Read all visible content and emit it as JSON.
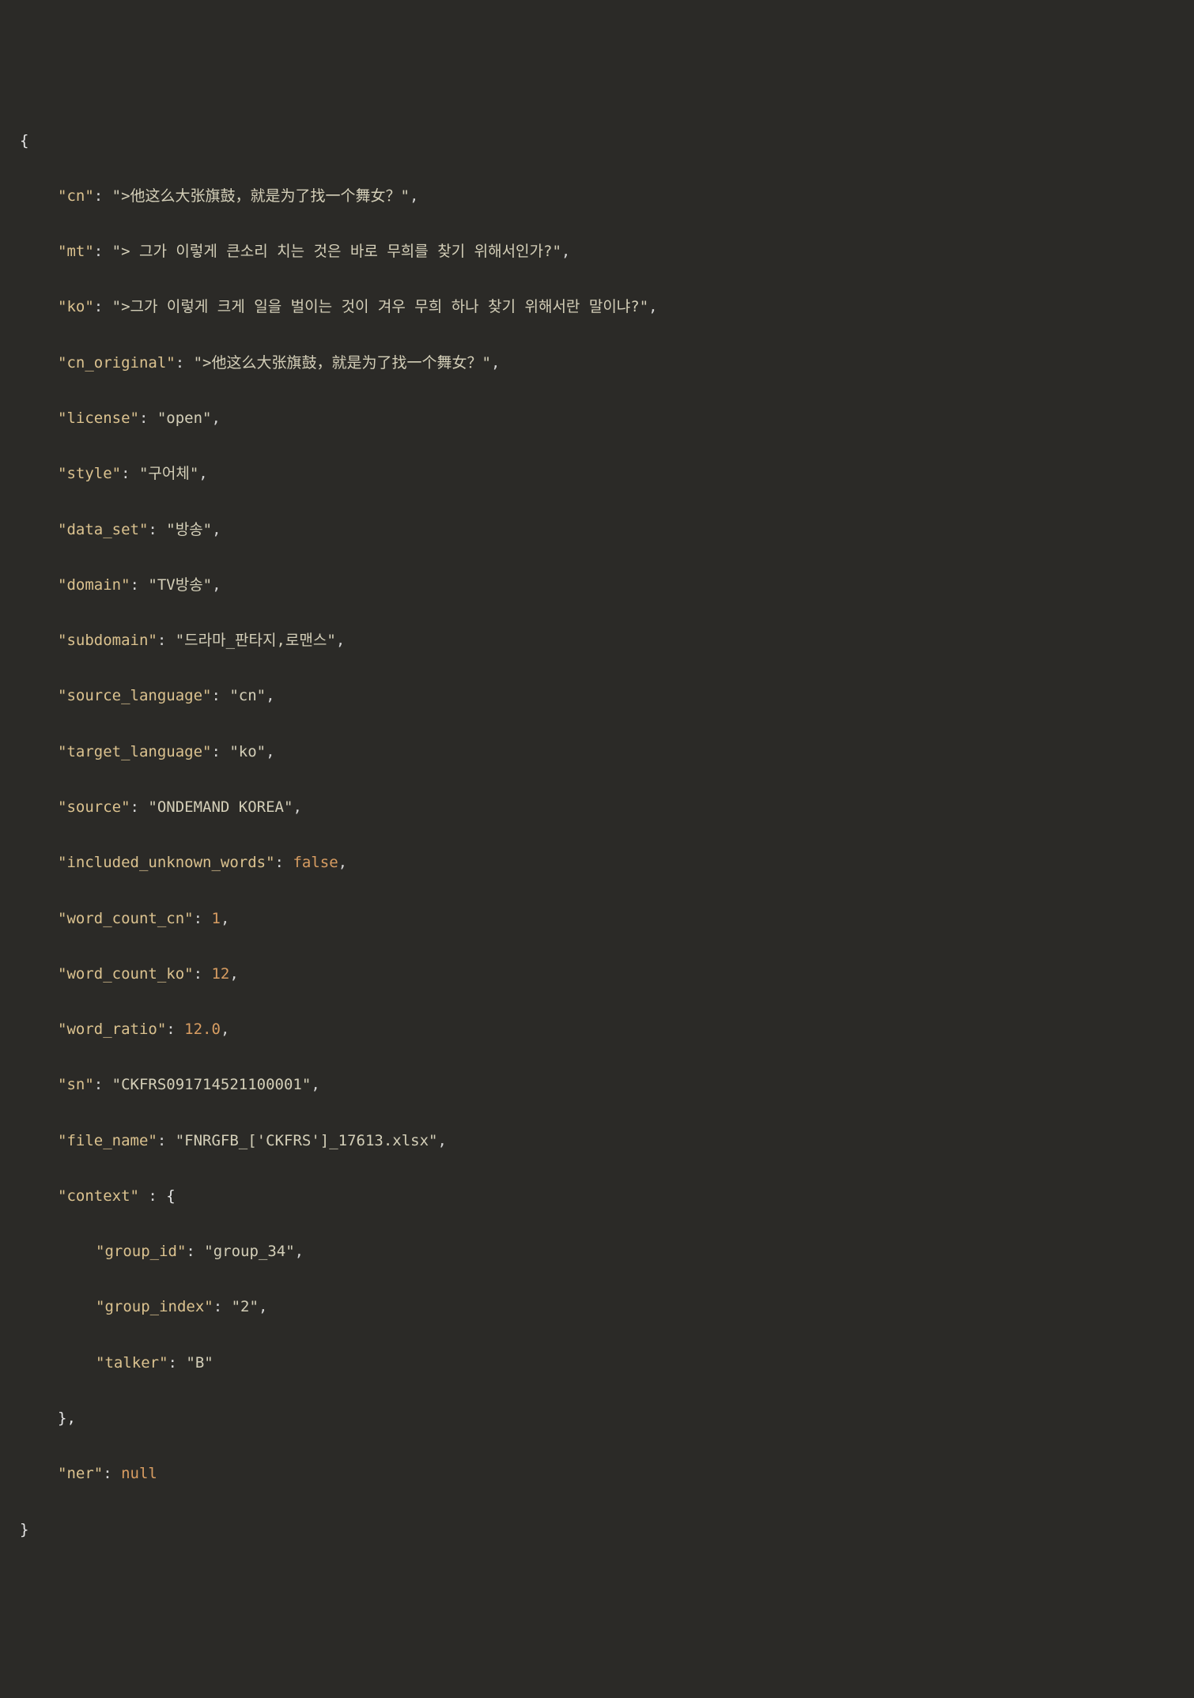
{
  "open_brace": "{",
  "close_brace": "}",
  "close_brace_comma": "},",
  "cn_key": "\"cn\"",
  "cn_val": "\">他这么大张旗鼓，就是为了找一个舞女？\"",
  "mt_key": "\"mt\"",
  "mt_val": "\"> 그가 이렇게 큰소리 치는 것은 바로 무희를 찾기 위해서인가?\"",
  "ko_key": "\"ko\"",
  "ko_val": "\">그가 이렇게 크게 일을 벌이는 것이 겨우 무희 하나 찾기 위해서란 말이냐?\"",
  "cn_original_key": "\"cn_original\"",
  "cn_original_val": "\">他这么大张旗鼓，就是为了找一个舞女？\"",
  "license_key": "\"license\"",
  "license_val": "\"open\"",
  "style_key": "\"style\"",
  "style_val": "\"구어체\"",
  "data_set_key": "\"data_set\"",
  "data_set_val": "\"방송\"",
  "domain_key": "\"domain\"",
  "domain_val": "\"TV방송\"",
  "subdomain_key": "\"subdomain\"",
  "subdomain_val": "\"드라마_판타지,로맨스\"",
  "source_language_key": "\"source_language\"",
  "source_language_val": "\"cn\"",
  "target_language_key": "\"target_language\"",
  "target_language_val": "\"ko\"",
  "source_key": "\"source\"",
  "source_val": "\"ONDEMAND KOREA\"",
  "included_unknown_words_key": "\"included_unknown_words\"",
  "included_unknown_words_val": "false",
  "word_count_cn_key": "\"word_count_cn\"",
  "word_count_cn_val": "1",
  "word_count_ko_key": "\"word_count_ko\"",
  "word_count_ko_val": "12",
  "word_ratio_key": "\"word_ratio\"",
  "word_ratio_val": "12.0",
  "sn_key": "\"sn\"",
  "sn_val": "\"CKFRS091714521100001\"",
  "file_name_key": "\"file_name\"",
  "file_name_val": "\"FNRGFB_['CKFRS']_17613.xlsx\"",
  "context_key": "\"context\"",
  "group_id_key": "\"group_id\"",
  "group_id_val": "\"group_34\"",
  "group_index_key": "\"group_index\"",
  "group_index_val": "\"2\"",
  "talker_key": "\"talker\"",
  "talker_val": "\"B\"",
  "ner_key": "\"ner\"",
  "ner_val": "null",
  "colon": ": ",
  "colon_sp": " : ",
  "comma": ","
}
